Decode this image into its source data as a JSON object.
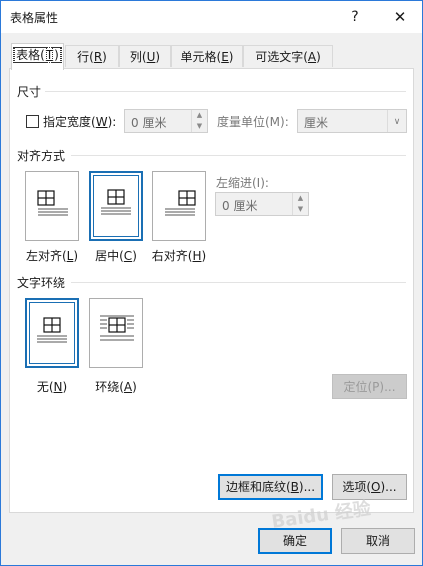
{
  "window": {
    "title": "表格属性",
    "help": "?",
    "close": "✕"
  },
  "tabs": [
    {
      "label": "表格(",
      "key": "T",
      "end": ")"
    },
    {
      "label": "行(",
      "key": "R",
      "end": ")"
    },
    {
      "label": "列(",
      "key": "U",
      "end": ")"
    },
    {
      "label": "单元格(",
      "key": "E",
      "end": ")"
    },
    {
      "label": "可选文字(",
      "key": "A",
      "end": ")"
    }
  ],
  "size": {
    "heading": "尺寸",
    "width_label": "指定宽度(",
    "width_key": "W",
    "width_end": "):",
    "width_value": "0 厘米",
    "unit_label": "度量单位(M):",
    "unit_value": "厘米"
  },
  "alignment": {
    "heading": "对齐方式",
    "options": [
      {
        "label": "左对齐(",
        "key": "L",
        "end": ")"
      },
      {
        "label": "居中(",
        "key": "C",
        "end": ")"
      },
      {
        "label": "右对齐(",
        "key": "H",
        "end": ")"
      }
    ],
    "indent_label": "左缩进(I):",
    "indent_value": "0 厘米"
  },
  "wrapping": {
    "heading": "文字环绕",
    "options": [
      {
        "label": "无(",
        "key": "N",
        "end": ")"
      },
      {
        "label": "环绕(",
        "key": "A",
        "end": ")"
      }
    ],
    "position_button": "定位(P)..."
  },
  "buttons": {
    "borders": "边框和底纹(",
    "borders_key": "B",
    "borders_end": ")...",
    "options": "选项(",
    "options_key": "O",
    "options_end": ")...",
    "ok": "确定",
    "cancel": "取消"
  },
  "watermark": "Baidu 经验"
}
